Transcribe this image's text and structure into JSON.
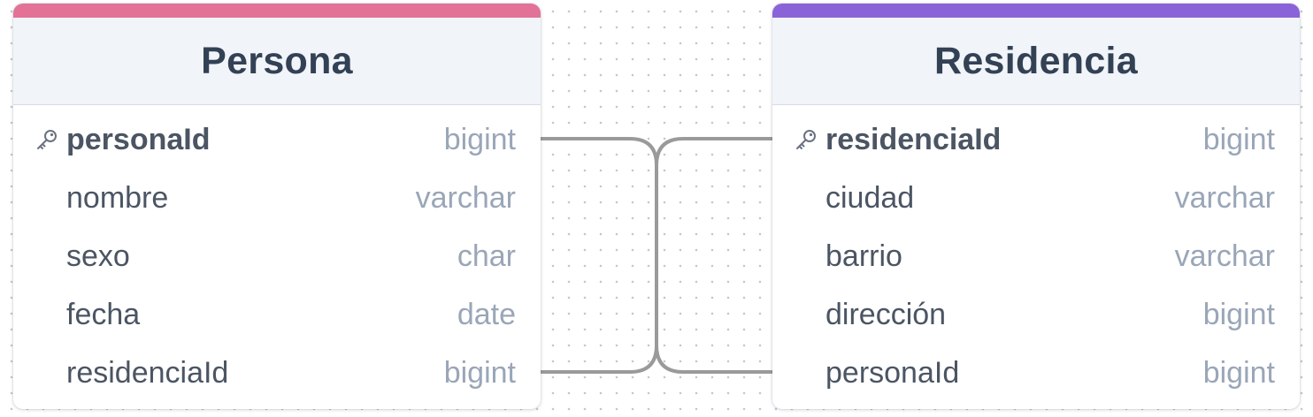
{
  "diagram": {
    "tables": [
      {
        "title": "Persona",
        "accent_color": "#e27396",
        "columns": [
          {
            "name": "personaId",
            "type": "bigint",
            "primary_key": true
          },
          {
            "name": "nombre",
            "type": "varchar",
            "primary_key": false
          },
          {
            "name": "sexo",
            "type": "char",
            "primary_key": false
          },
          {
            "name": "fecha",
            "type": "date",
            "primary_key": false
          },
          {
            "name": "residenciaId",
            "type": "bigint",
            "primary_key": false
          }
        ]
      },
      {
        "title": "Residencia",
        "accent_color": "#8b63d9",
        "columns": [
          {
            "name": "residenciaId",
            "type": "bigint",
            "primary_key": true
          },
          {
            "name": "ciudad",
            "type": "varchar",
            "primary_key": false
          },
          {
            "name": "barrio",
            "type": "varchar",
            "primary_key": false
          },
          {
            "name": "dirección",
            "type": "bigint",
            "primary_key": false
          },
          {
            "name": "personaId",
            "type": "bigint",
            "primary_key": false
          }
        ]
      }
    ],
    "relations": [
      {
        "from_table": "Persona",
        "from_column": "personaId",
        "to_table": "Residencia",
        "to_column": "personaId"
      },
      {
        "from_table": "Persona",
        "from_column": "residenciaId",
        "to_table": "Residencia",
        "to_column": "residenciaId"
      }
    ],
    "connector_color": "#9a9a9a"
  }
}
